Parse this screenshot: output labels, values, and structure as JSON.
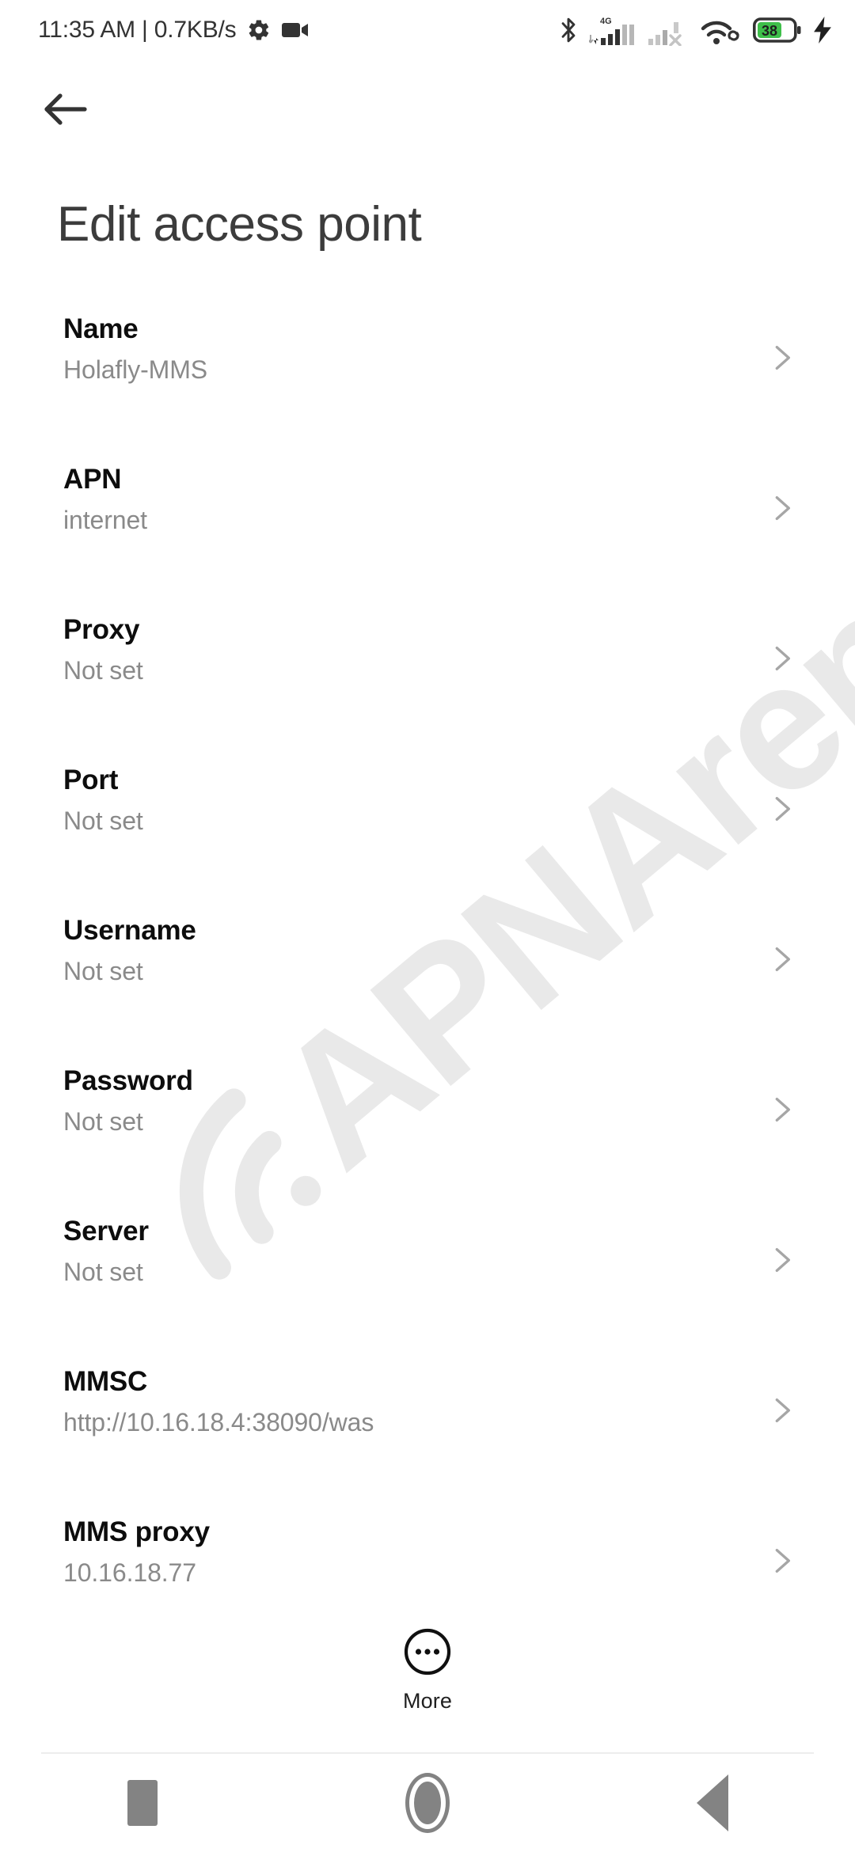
{
  "status_bar": {
    "clock_and_speed": "11:35 AM | 0.7KB/s",
    "left_icons": [
      "gear-icon",
      "video-camera-icon"
    ],
    "right_icons": [
      "bluetooth-icon",
      "signal-4g-icon",
      "signal-no-service-icon",
      "wifi-vpn-icon",
      "battery-icon",
      "charging-bolt-icon"
    ],
    "network_label": "4G",
    "battery_percent": "38",
    "battery_color": "#3fbf4a"
  },
  "toolbar": {
    "back_label": "back-arrow"
  },
  "header": {
    "title": "Edit access point"
  },
  "list": {
    "items": [
      {
        "title": "Name",
        "value": "Holafly-MMS"
      },
      {
        "title": "APN",
        "value": "internet"
      },
      {
        "title": "Proxy",
        "value": "Not set"
      },
      {
        "title": "Port",
        "value": "Not set"
      },
      {
        "title": "Username",
        "value": "Not set"
      },
      {
        "title": "Password",
        "value": "Not set"
      },
      {
        "title": "Server",
        "value": "Not set"
      },
      {
        "title": "MMSC",
        "value": "http://10.16.18.4:38090/was"
      },
      {
        "title": "MMS proxy",
        "value": "10.16.18.77"
      }
    ]
  },
  "more": {
    "label": "More",
    "icon": "more-dots-circle-icon"
  },
  "watermark": {
    "text": "APNArena",
    "color": "#e9e9e9"
  },
  "nav_bar": {
    "recents_label": "recents-square",
    "home_label": "home-circle",
    "back_label": "back-triangle",
    "color": "#838383"
  }
}
